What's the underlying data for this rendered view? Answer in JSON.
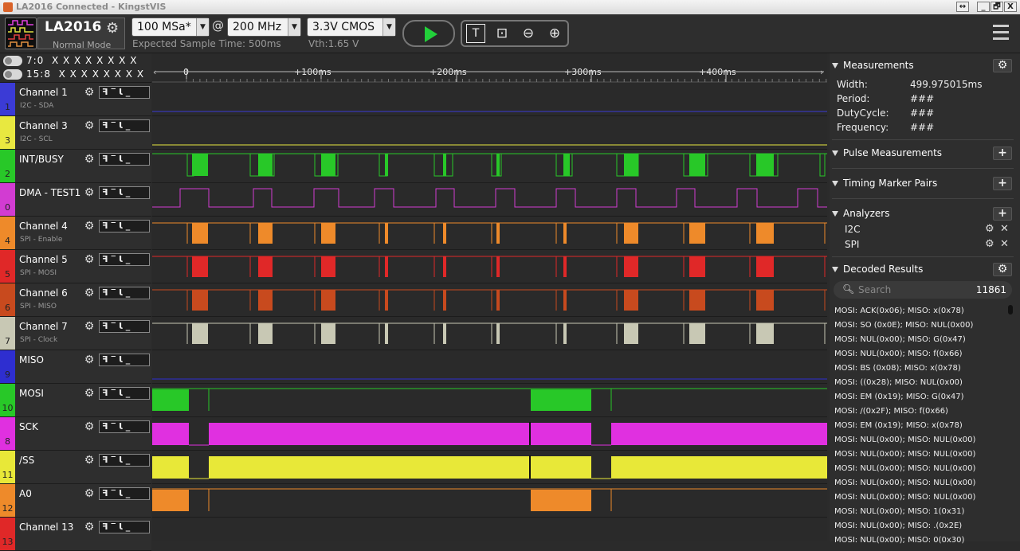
{
  "window": {
    "title": "LA2016 Connected - KingstVIS",
    "ctrl_restore": "↔",
    "ctrl_min": "_",
    "ctrl_max": "🗗",
    "ctrl_close": "X"
  },
  "toolbar": {
    "device_name": "LA2016",
    "device_mode": "Normal Mode",
    "sample_rate": "100 MSa*",
    "at_symbol": "@",
    "frequency": "200 MHz",
    "sample_time": "Expected Sample Time: 500ms",
    "logic_level": "3.3V CMOS",
    "threshold": "Vth:1.65 V"
  },
  "header": {
    "groups": [
      {
        "label": "7:0",
        "bits": "X X X X X X X X"
      },
      {
        "label": "15:8",
        "bits": "X X X X X X X X"
      }
    ]
  },
  "timeline": {
    "ticks": [
      "0",
      "+100ms",
      "+200ms",
      "+300ms",
      "+400ms"
    ]
  },
  "channels": [
    {
      "num": "1",
      "name": "Channel 1",
      "sub": "I2C - SDA",
      "color": "#3b3bd6"
    },
    {
      "num": "3",
      "name": "Channel 3",
      "sub": "I2C - SCL",
      "color": "#e8e840"
    },
    {
      "num": "2",
      "name": "INT/BUSY",
      "sub": "",
      "color": "#28c828"
    },
    {
      "num": "0",
      "name": "DMA - TEST1",
      "sub": "",
      "color": "#d23cd2"
    },
    {
      "num": "4",
      "name": "Channel 4",
      "sub": "SPI - Enable",
      "color": "#ee8a2a"
    },
    {
      "num": "5",
      "name": "Channel 5",
      "sub": "SPI - MOSI",
      "color": "#e02828"
    },
    {
      "num": "6",
      "name": "Channel 6",
      "sub": "SPI - MISO",
      "color": "#c84a1e"
    },
    {
      "num": "7",
      "name": "Channel 7",
      "sub": "SPI - Clock",
      "color": "#c8c8b4"
    },
    {
      "num": "9",
      "name": "MISO",
      "sub": "",
      "color": "#2e2ed0"
    },
    {
      "num": "10",
      "name": "MOSI",
      "sub": "",
      "color": "#28c828"
    },
    {
      "num": "8",
      "name": "SCK",
      "sub": "",
      "color": "#e030e0"
    },
    {
      "num": "11",
      "name": "/SS",
      "sub": "",
      "color": "#e8e838"
    },
    {
      "num": "12",
      "name": "A0",
      "sub": "",
      "color": "#ee8a2a"
    },
    {
      "num": "13",
      "name": "Channel 13",
      "sub": "",
      "color": "#e02828"
    }
  ],
  "trigger_glyphs": "ꟻ‾Ɩ_",
  "panel": {
    "measurements": {
      "title": "Measurements",
      "rows": [
        {
          "label": "Width:",
          "value": "499.975015ms"
        },
        {
          "label": "Period:",
          "value": "###"
        },
        {
          "label": "DutyCycle:",
          "value": "###"
        },
        {
          "label": "Frequency:",
          "value": "###"
        }
      ]
    },
    "pulse_title": "Pulse Measurements",
    "marker_title": "Timing Marker Pairs",
    "analyzers": {
      "title": "Analyzers",
      "items": [
        "I2C",
        "SPI"
      ]
    },
    "decoded": {
      "title": "Decoded Results",
      "search_placeholder": "Search",
      "count": "11861",
      "rows": [
        "MOSI: ACK(0x06);  MISO: x(0x78)",
        "MOSI: SO (0x0E);  MISO: NUL(0x00)",
        "MOSI: NUL(0x00);  MISO: G(0x47)",
        "MOSI: NUL(0x00);  MISO: f(0x66)",
        "MOSI: BS (0x08);  MISO: x(0x78)",
        "MOSI: ((0x28);  MISO: NUL(0x00)",
        "MOSI: EM (0x19);  MISO: G(0x47)",
        "MOSI: /(0x2F);  MISO: f(0x66)",
        "MOSI: EM (0x19);  MISO: x(0x78)",
        "MOSI: NUL(0x00);  MISO: NUL(0x00)",
        "MOSI: NUL(0x00);  MISO: NUL(0x00)",
        "MOSI: NUL(0x00);  MISO: NUL(0x00)",
        "MOSI: NUL(0x00);  MISO: NUL(0x00)",
        "MOSI: NUL(0x00);  MISO: NUL(0x00)",
        "MOSI: NUL(0x00);  MISO: 1(0x31)",
        "MOSI: NUL(0x00);  MISO: .(0x2E)",
        "MOSI: NUL(0x00);  MISO: 0(0x30)"
      ]
    }
  }
}
